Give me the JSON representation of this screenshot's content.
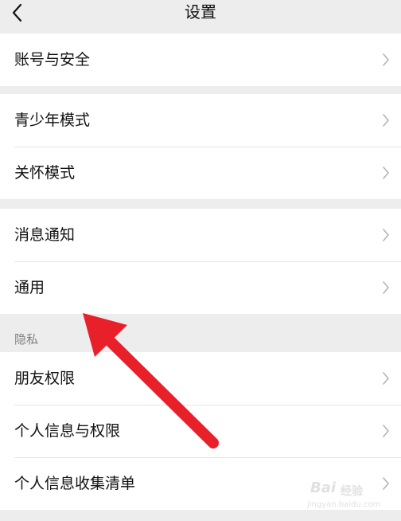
{
  "header": {
    "title": "设置",
    "back_icon": "chevron-left-icon"
  },
  "groups": [
    {
      "items": [
        {
          "label": "账号与安全"
        }
      ]
    },
    {
      "items": [
        {
          "label": "青少年模式"
        },
        {
          "label": "关怀模式"
        }
      ]
    },
    {
      "items": [
        {
          "label": "消息通知"
        },
        {
          "label": "通用"
        }
      ]
    },
    {
      "section_label": "隐私",
      "items": [
        {
          "label": "朋友权限"
        },
        {
          "label": "个人信息与权限"
        },
        {
          "label": "个人信息收集清单"
        }
      ]
    }
  ],
  "annotation": {
    "arrow_color": "#e8202a"
  },
  "watermark": {
    "brand": "Bai",
    "sub": "经验",
    "url": "jingyan.baidu.com"
  },
  "colors": {
    "background": "#ededed",
    "row": "#ffffff",
    "divider": "#e6e6e6",
    "chevron": "#b3b3b3"
  }
}
